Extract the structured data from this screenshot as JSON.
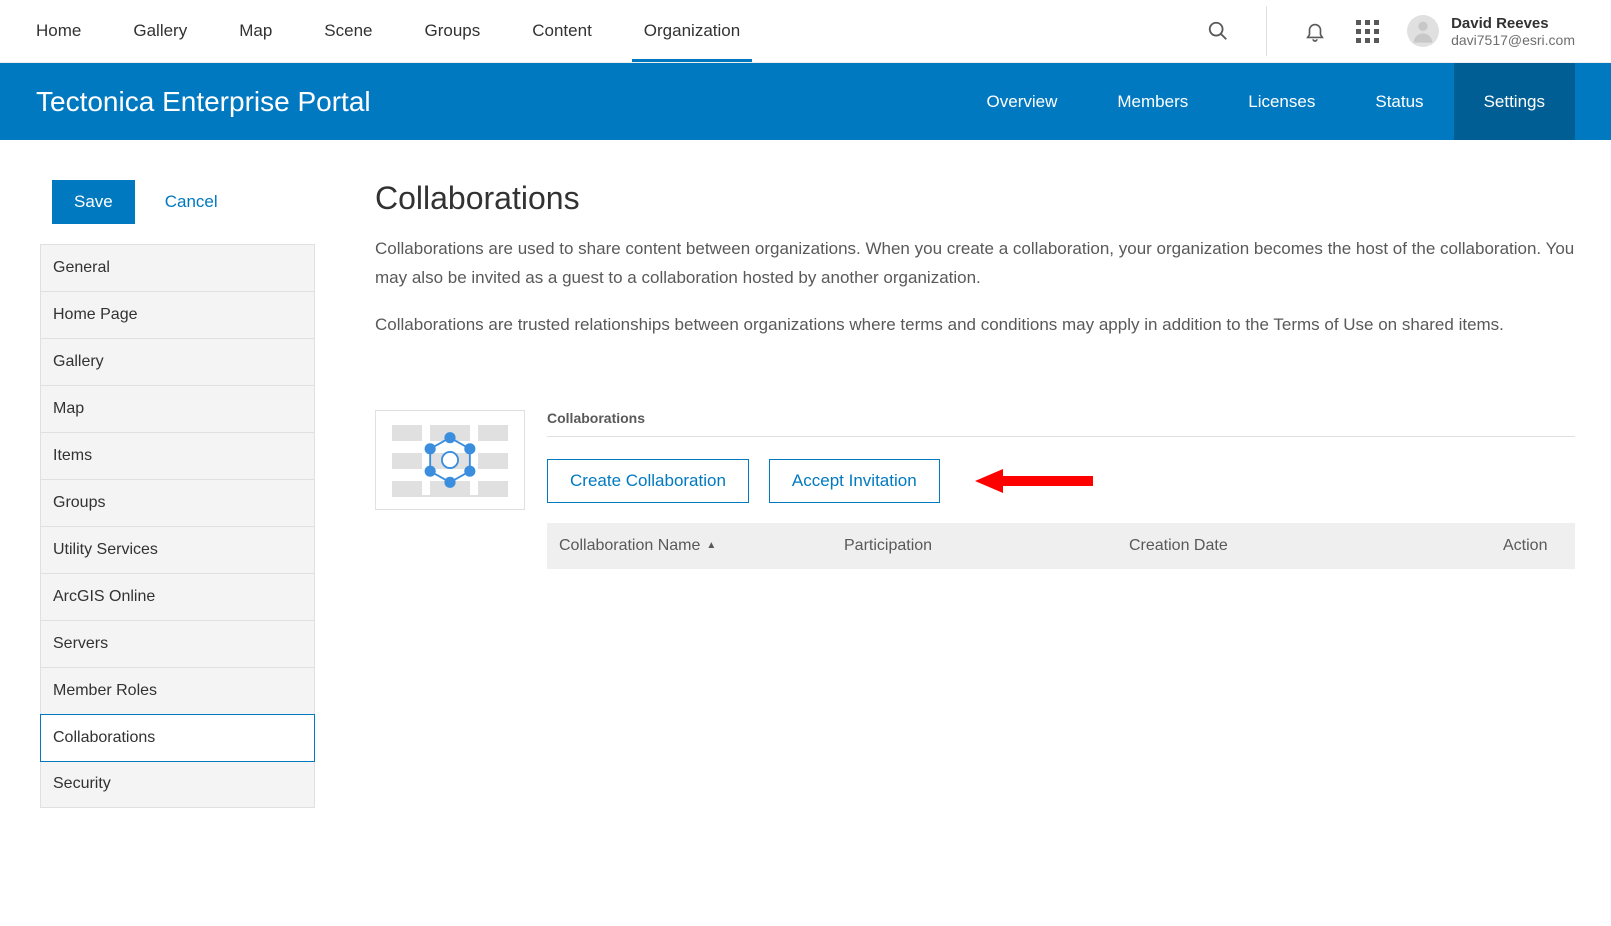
{
  "topnav": {
    "items": [
      "Home",
      "Gallery",
      "Map",
      "Scene",
      "Groups",
      "Content",
      "Organization"
    ],
    "active_index": 6
  },
  "user": {
    "name": "David Reeves",
    "email": "davi7517@esri.com"
  },
  "orgbar": {
    "title": "Tectonica Enterprise Portal",
    "tabs": [
      "Overview",
      "Members",
      "Licenses",
      "Status",
      "Settings"
    ],
    "active_index": 4
  },
  "actions": {
    "save": "Save",
    "cancel": "Cancel"
  },
  "sidebar": {
    "items": [
      "General",
      "Home Page",
      "Gallery",
      "Map",
      "Items",
      "Groups",
      "Utility Services",
      "ArcGIS Online",
      "Servers",
      "Member Roles",
      "Collaborations",
      "Security"
    ],
    "active_index": 10
  },
  "page": {
    "title": "Collaborations",
    "desc1": "Collaborations are used to share content between organizations. When you create a collaboration, your organization becomes the host of the collaboration. You may also be invited as a guest to a collaboration hosted by another organization.",
    "desc2": "Collaborations are trusted relationships between organizations where terms and conditions may apply in addition to the Terms of Use on shared items."
  },
  "section": {
    "label": "Collaborations",
    "create_btn": "Create Collaboration",
    "accept_btn": "Accept Invitation"
  },
  "table": {
    "headers": {
      "name": "Collaboration Name",
      "participation": "Participation",
      "date": "Creation Date",
      "action": "Action"
    }
  }
}
